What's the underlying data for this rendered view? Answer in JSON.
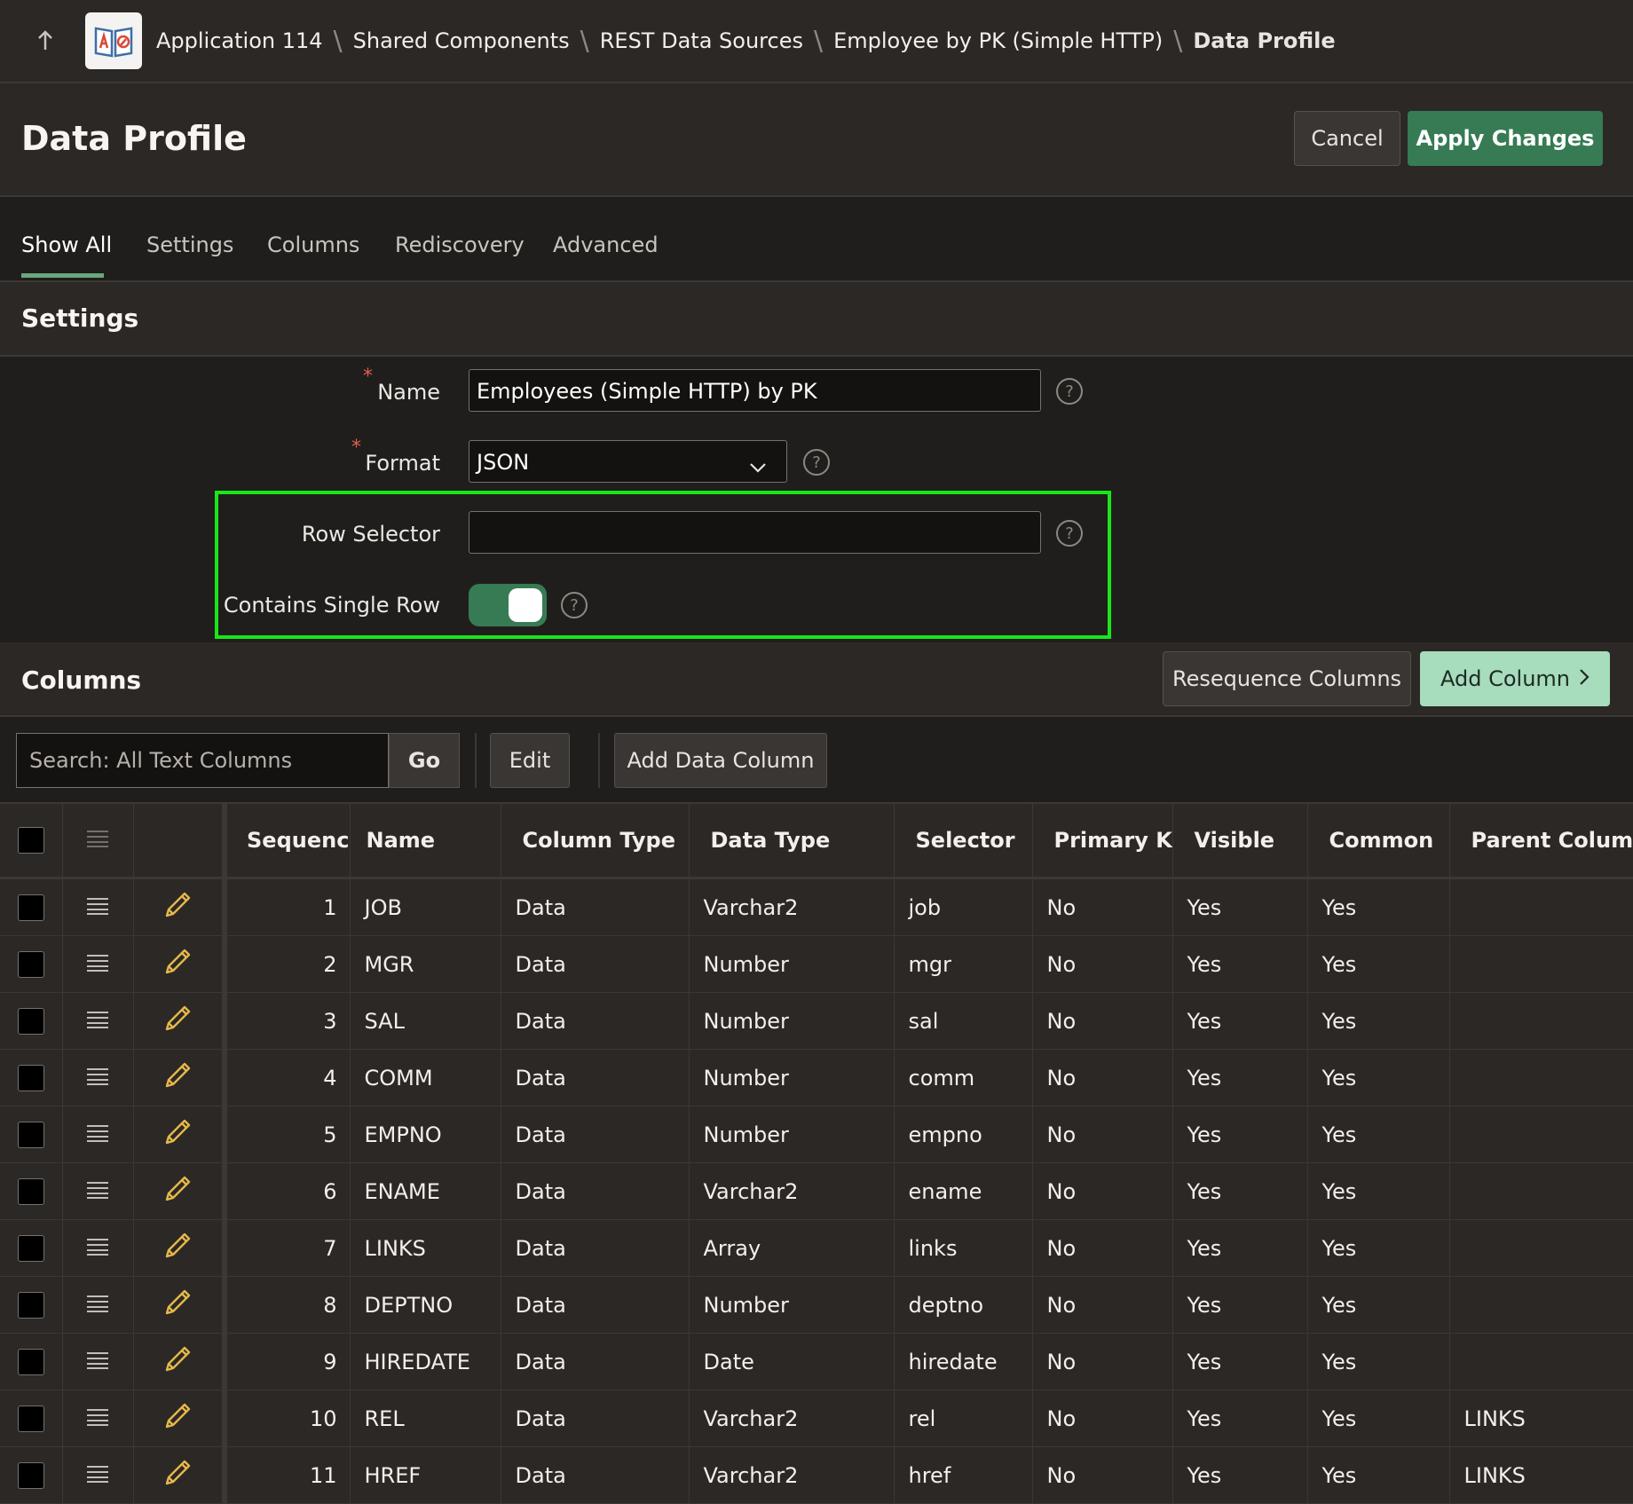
{
  "breadcrumb": {
    "items": [
      "Application 114",
      "Shared Components",
      "REST Data Sources",
      "Employee by PK (Simple HTTP)"
    ],
    "current": "Data Profile"
  },
  "header": {
    "title": "Data Profile",
    "cancel_label": "Cancel",
    "apply_label": "Apply Changes"
  },
  "tabs": [
    "Show All",
    "Settings",
    "Columns",
    "Rediscovery",
    "Advanced"
  ],
  "settings": {
    "title": "Settings",
    "name_label": "Name",
    "name_value": "Employees (Simple HTTP) by PK",
    "format_label": "Format",
    "format_value": "JSON",
    "row_selector_label": "Row Selector",
    "row_selector_value": "",
    "single_row_label": "Contains Single Row",
    "single_row_on": true,
    "required_mark": "*",
    "help_glyph": "?"
  },
  "columns_region": {
    "title": "Columns",
    "resequence_label": "Resequence Columns",
    "add_column_label": "Add Column",
    "search_placeholder": "Search: All Text Columns",
    "go_label": "Go",
    "edit_label": "Edit",
    "add_data_column_label": "Add Data Column"
  },
  "table": {
    "headers": [
      "Sequence",
      "Name",
      "Column Type",
      "Data Type",
      "Selector",
      "Primary Key",
      "Visible",
      "Common",
      "Parent Column"
    ],
    "rows": [
      [
        "1",
        "JOB",
        "Data",
        "Varchar2",
        "job",
        "No",
        "Yes",
        "Yes",
        ""
      ],
      [
        "2",
        "MGR",
        "Data",
        "Number",
        "mgr",
        "No",
        "Yes",
        "Yes",
        ""
      ],
      [
        "3",
        "SAL",
        "Data",
        "Number",
        "sal",
        "No",
        "Yes",
        "Yes",
        ""
      ],
      [
        "4",
        "COMM",
        "Data",
        "Number",
        "comm",
        "No",
        "Yes",
        "Yes",
        ""
      ],
      [
        "5",
        "EMPNO",
        "Data",
        "Number",
        "empno",
        "No",
        "Yes",
        "Yes",
        ""
      ],
      [
        "6",
        "ENAME",
        "Data",
        "Varchar2",
        "ename",
        "No",
        "Yes",
        "Yes",
        ""
      ],
      [
        "7",
        "LINKS",
        "Data",
        "Array",
        "links",
        "No",
        "Yes",
        "Yes",
        ""
      ],
      [
        "8",
        "DEPTNO",
        "Data",
        "Number",
        "deptno",
        "No",
        "Yes",
        "Yes",
        ""
      ],
      [
        "9",
        "HIREDATE",
        "Data",
        "Date",
        "hiredate",
        "No",
        "Yes",
        "Yes",
        ""
      ],
      [
        "10",
        "REL",
        "Data",
        "Varchar2",
        "rel",
        "No",
        "Yes",
        "Yes",
        "LINKS"
      ],
      [
        "11",
        "HREF",
        "Data",
        "Varchar2",
        "href",
        "No",
        "Yes",
        "Yes",
        "LINKS"
      ]
    ]
  },
  "colors": {
    "accent": "#367b54",
    "highlight": "#1ae51a",
    "add_column_bg": "#a7dcbd"
  },
  "icons": [
    "up-arrow-icon",
    "app-icon",
    "chevron-down-icon",
    "help-icon",
    "chevron-right-icon",
    "row-actions-icon",
    "pencil-icon"
  ]
}
